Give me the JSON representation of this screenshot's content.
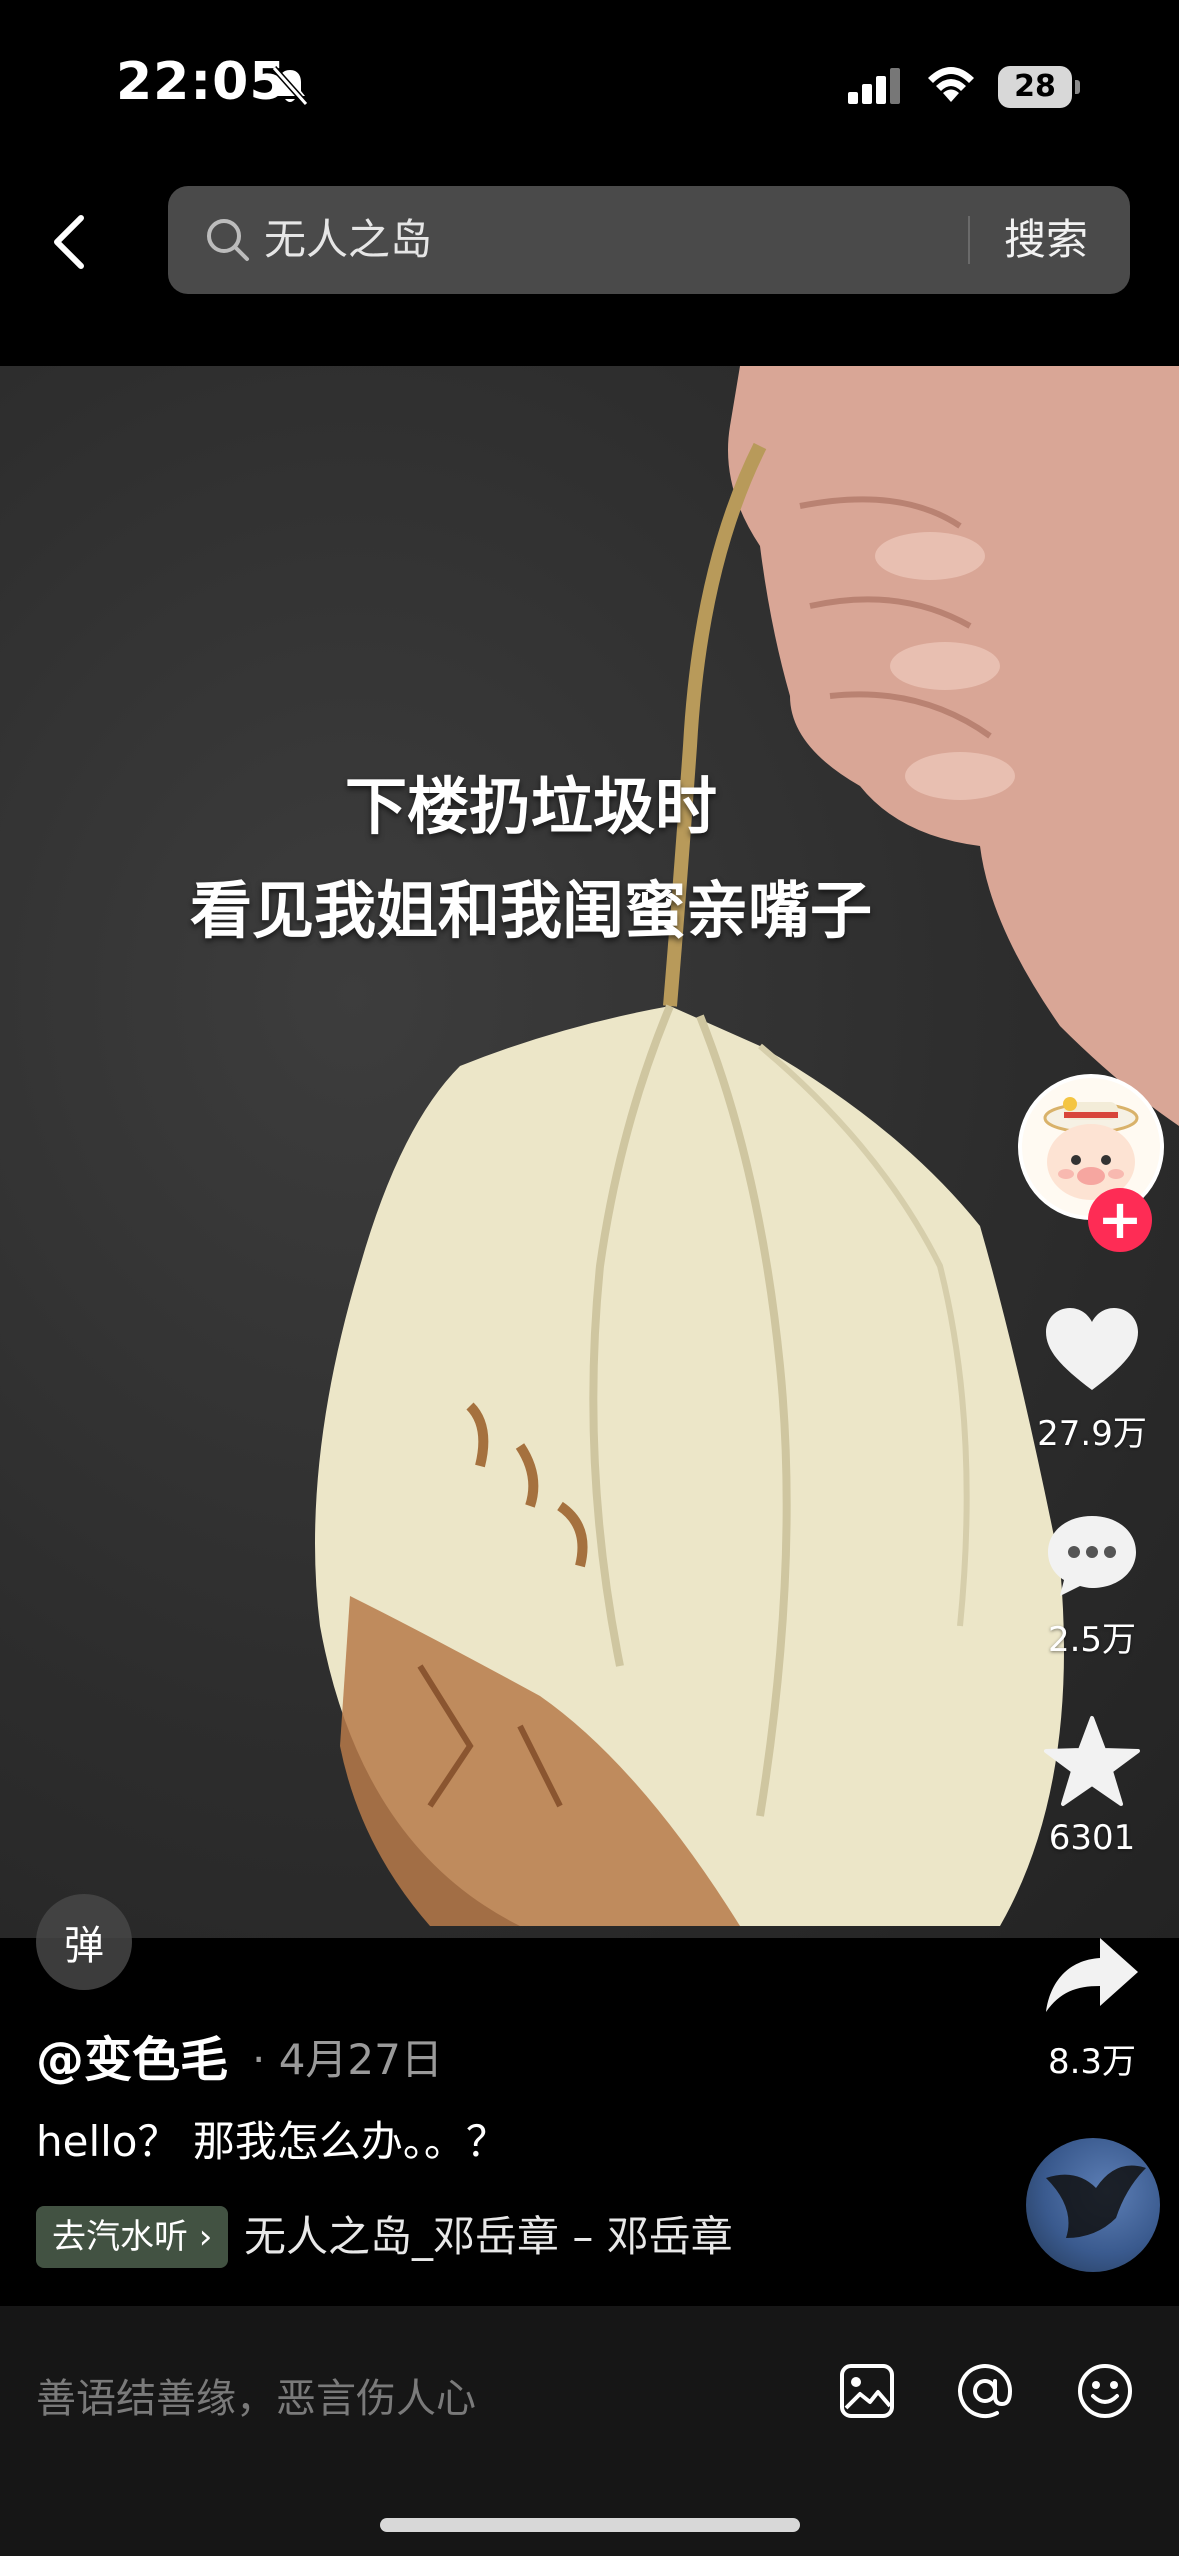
{
  "status_bar": {
    "time": "22:05",
    "battery": "28"
  },
  "search": {
    "query": "无人之岛",
    "button_label": "搜索"
  },
  "video": {
    "caption_line1": "下楼扔垃圾时",
    "caption_line2": "看见我姐和我闺蜜亲嘴子"
  },
  "actions": {
    "follow_label": "+",
    "likes": "27.9万",
    "comments": "2.5万",
    "favorites": "6301",
    "shares": "8.3万"
  },
  "post": {
    "danmu_label": "弹",
    "author": "@变色毛",
    "date": "· 4月27日",
    "description": "hello？ 那我怎么办。。？",
    "listen_tag": "去汽水听 ›",
    "music_title": "无人之岛_邓岳章 – 邓岳章"
  },
  "comment_bar": {
    "placeholder": "善语结善缘，恶言伤人心"
  },
  "colors": {
    "accent_red": "#fe2c55",
    "background": "#000000",
    "search_bg": "#4a4a4a"
  },
  "icons": [
    "bell-muted-icon",
    "signal-icon",
    "wifi-icon",
    "battery-icon",
    "back-icon",
    "search-icon",
    "heart-icon",
    "comment-icon",
    "star-icon",
    "share-icon",
    "image-icon",
    "at-icon",
    "emoji-icon"
  ]
}
